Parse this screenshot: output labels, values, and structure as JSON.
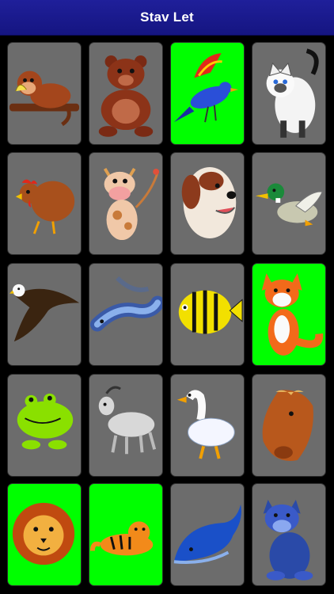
{
  "header": {
    "title": "Stav Let"
  },
  "colors": {
    "nav": "#151581",
    "card_gray": "#6c6c6c",
    "card_green": "#00ff00"
  },
  "cards": [
    {
      "icon": "monkey-icon",
      "state": "gray"
    },
    {
      "icon": "bear-icon",
      "state": "gray"
    },
    {
      "icon": "bird-icon",
      "state": "green"
    },
    {
      "icon": "cat-icon",
      "state": "gray"
    },
    {
      "icon": "hen-icon",
      "state": "gray"
    },
    {
      "icon": "cow-icon",
      "state": "gray"
    },
    {
      "icon": "dog-icon",
      "state": "gray"
    },
    {
      "icon": "duck-icon",
      "state": "gray"
    },
    {
      "icon": "eagle-icon",
      "state": "gray"
    },
    {
      "icon": "eel-icon",
      "state": "gray"
    },
    {
      "icon": "fish-icon",
      "state": "gray"
    },
    {
      "icon": "fox-icon",
      "state": "green"
    },
    {
      "icon": "frog-icon",
      "state": "gray"
    },
    {
      "icon": "goat-icon",
      "state": "gray"
    },
    {
      "icon": "goose-icon",
      "state": "gray"
    },
    {
      "icon": "horse-icon",
      "state": "gray"
    },
    {
      "icon": "lion-icon",
      "state": "green"
    },
    {
      "icon": "tiger-icon",
      "state": "green"
    },
    {
      "icon": "whale-icon",
      "state": "gray"
    },
    {
      "icon": "wolf-icon",
      "state": "gray"
    }
  ]
}
